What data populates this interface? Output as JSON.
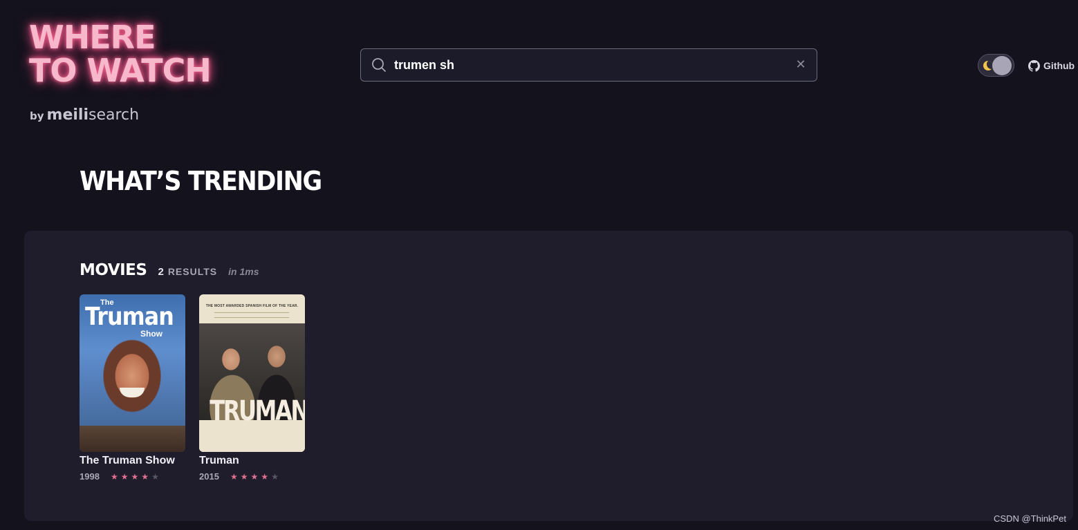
{
  "logo": {
    "line1": "WHERE",
    "line2": "TO WATCH",
    "by": "by",
    "brand_bold": "meili",
    "brand_light": "search"
  },
  "search": {
    "value": "trumen sh",
    "placeholder": ""
  },
  "theme_toggle": {
    "state": "dark"
  },
  "github": {
    "label": "Github"
  },
  "heading": "WHAT’S TRENDING",
  "section": {
    "title": "MOVIES",
    "count": "2",
    "results_label": "RESULTS",
    "timing": "in 1ms"
  },
  "movies": [
    {
      "title": "The Truman Show",
      "year": "1998",
      "rating": 4,
      "max_rating": 5,
      "poster": {
        "small": "The",
        "main": "Truman",
        "sub": "Show"
      }
    },
    {
      "title": "Truman",
      "year": "2015",
      "rating": 4,
      "max_rating": 5,
      "poster": {
        "tagline": "THE MOST AWARDED SPANISH FILM OF THE YEAR.",
        "main": "TRUMAN"
      }
    }
  ],
  "colors": {
    "background": "#13121d",
    "panel": "#1f1d2b",
    "logo_glow": "#e64b7e",
    "star_on": "#e0708f",
    "star_off": "#5a5667"
  },
  "watermark": "CSDN @ThinkPet"
}
